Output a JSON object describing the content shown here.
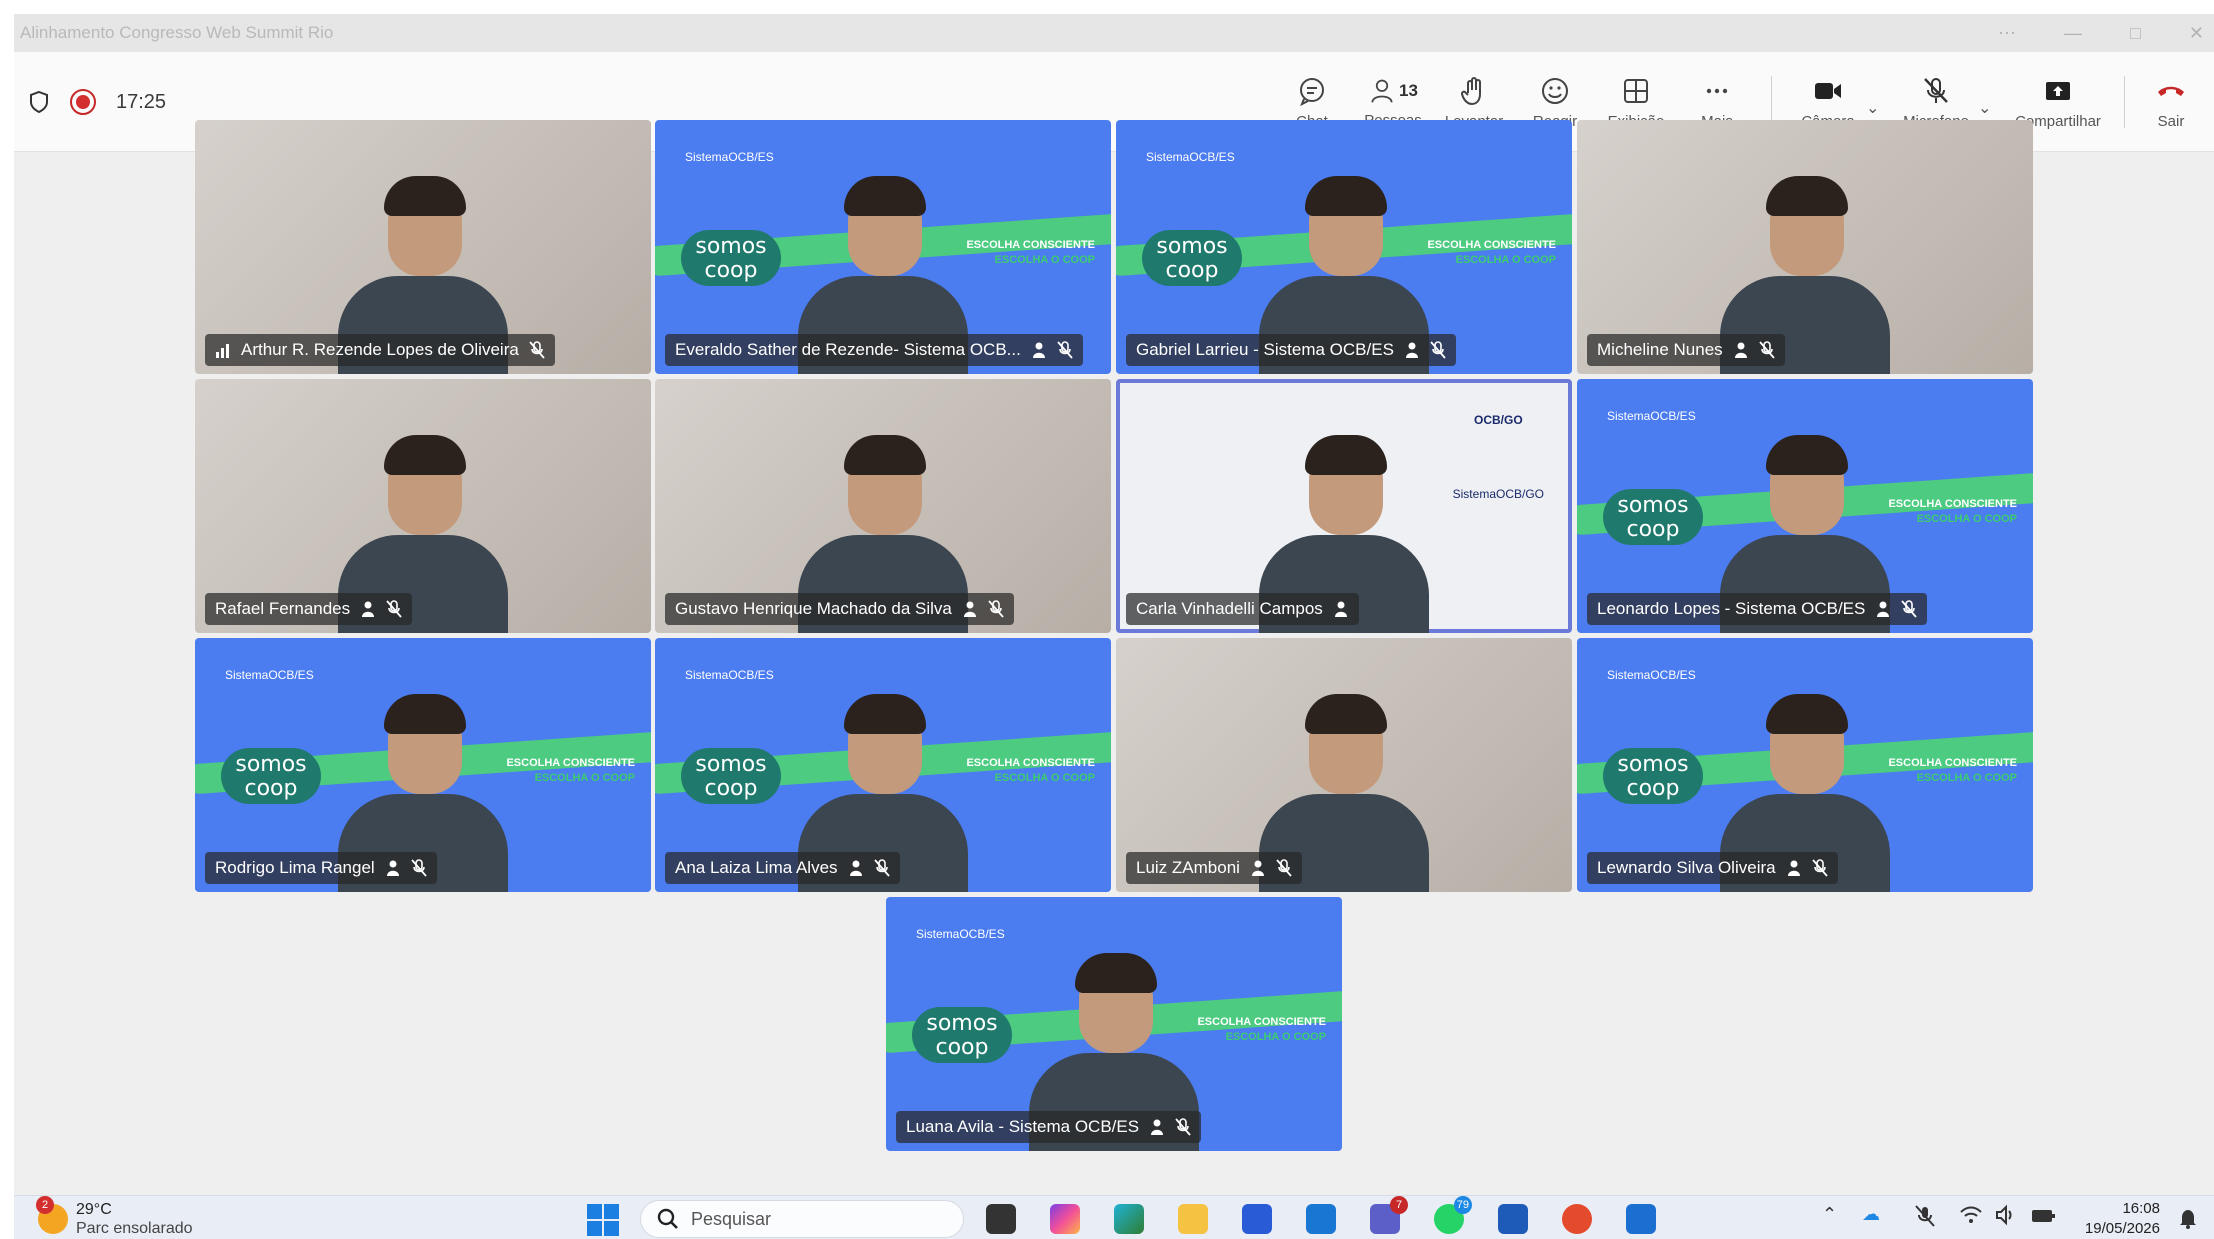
{
  "window": {
    "title": "Alinhamento Congresso Web Summit Rio",
    "controls": [
      "⋯",
      "—",
      "□",
      "✕"
    ]
  },
  "toolbar": {
    "timer": "17:25",
    "buttons": {
      "chat": "Chat",
      "people": "Pessoas",
      "people_count": "13",
      "raise": "Levantar",
      "react": "Reagir",
      "view": "Exibição",
      "more": "Mais",
      "camera": "Câmera",
      "mic": "Microfone",
      "share": "Compartilhar",
      "leave": "Sair"
    },
    "accent_leave": "#c62828"
  },
  "participants": [
    {
      "name": "Arthur R. Rezende Lopes de Oliveira",
      "bg": "photo",
      "icon": "signal-bars-icon"
    },
    {
      "name": "Everaldo Sather de Rezende- Sistema OCB...",
      "bg": "blue",
      "icon": "camera-off-badge-icon"
    },
    {
      "name": "Gabriel Larrieu - Sistema OCB/ES",
      "bg": "blue",
      "icon": "camera-off-badge-icon"
    },
    {
      "name": "Micheline Nunes",
      "bg": "photo",
      "icon": "camera-off-badge-icon"
    },
    {
      "name": "Rafael Fernandes",
      "bg": "photo",
      "icon": "camera-off-badge-icon"
    },
    {
      "name": "Gustavo Henrique Machado da Silva",
      "bg": "photo",
      "icon": "camera-off-badge-icon"
    },
    {
      "name": "Carla Vinhadelli Campos",
      "bg": "photo",
      "icon": "camera-off-badge-icon",
      "speaking": true
    },
    {
      "name": "Leonardo Lopes - Sistema OCB/ES",
      "bg": "blue",
      "icon": "camera-off-badge-icon"
    },
    {
      "name": "Rodrigo Lima Rangel",
      "bg": "blue",
      "icon": "camera-off-badge-icon"
    },
    {
      "name": "Ana Laiza Lima Alves",
      "bg": "blue",
      "icon": "camera-off-badge-icon"
    },
    {
      "name": "Luiz ZAmboni",
      "bg": "photo",
      "icon": "camera-off-badge-icon"
    },
    {
      "name": "Lewnardo Silva Oliveira",
      "bg": "blue",
      "icon": "camera-off-badge-icon"
    },
    {
      "name": "Luana Avila - Sistema OCB/ES",
      "bg": "blue",
      "icon": "camera-off-badge-icon"
    }
  ],
  "backdrop": {
    "brand_small": "SistemaOCB/ES",
    "logo": "somos coop",
    "tagline1": "ESCOLHA CONSCIENTE",
    "tagline2": "ESCOLHA O COOP",
    "ocbgo": "OCB/GO",
    "ocbgo_sub": "SistemaOCB/GO"
  },
  "taskbar": {
    "weather_badge": "2",
    "temp": "29°C",
    "condition": "Parc ensolarado",
    "search_placeholder": "Pesquisar",
    "badges": {
      "teams": "7",
      "whatsapp": "79"
    },
    "time": "16:08",
    "date": "19/05/2026"
  }
}
